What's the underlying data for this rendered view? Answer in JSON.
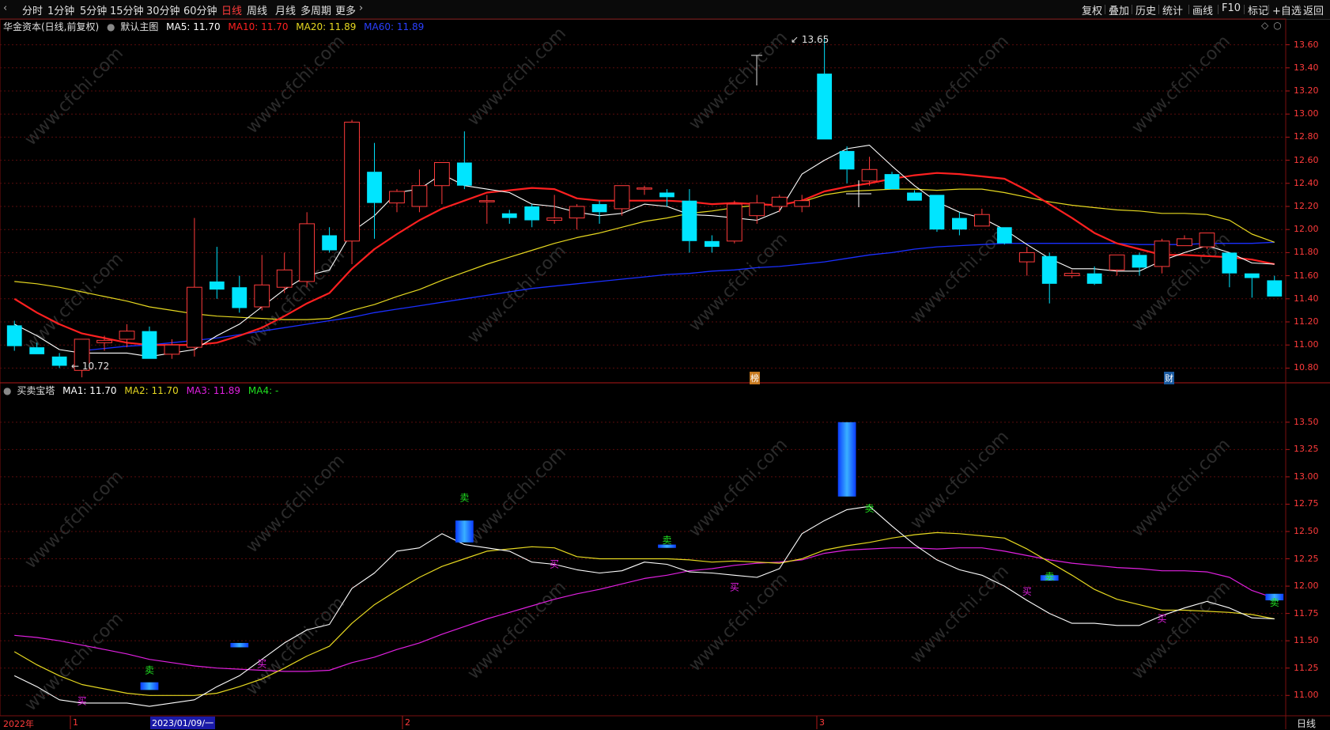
{
  "toolbar": {
    "periods": [
      "分时",
      "1分钟",
      "5分钟",
      "15分钟",
      "30分钟",
      "60分钟",
      "日线",
      "周线",
      "月线",
      "多周期",
      "更多"
    ],
    "active_period": "日线",
    "more_arrow": "›",
    "right_items": [
      "复权",
      "叠加",
      "历史",
      "统计",
      "画线",
      "F10",
      "标记",
      "+自选",
      "返回"
    ]
  },
  "main_panel": {
    "stock_title": "华金资本(日线,前复权)",
    "indicator_name": "默认主图",
    "ma5": "MA5: 11.70",
    "ma10": "MA10: 11.70",
    "ma20": "MA20: 11.89",
    "ma60": "MA60: 11.89",
    "high_label": "13.65",
    "low_label": "10.72",
    "badge_bang": "榜",
    "badge_cai": "财",
    "y_ticks": [
      "13.60",
      "13.40",
      "13.20",
      "13.00",
      "12.80",
      "12.60",
      "12.40",
      "12.20",
      "12.00",
      "11.80",
      "11.60",
      "11.40",
      "11.20",
      "11.00",
      "10.80"
    ]
  },
  "sub_panel": {
    "indicator_name": "买卖宝塔",
    "ma1": "MA1: 11.70",
    "ma2": "MA2: 11.70",
    "ma3": "MA3: 11.89",
    "ma4": "MA4: -",
    "buy_label": "买",
    "sell_label": "卖",
    "y_ticks": [
      "13.50",
      "13.25",
      "13.00",
      "12.75",
      "12.50",
      "12.25",
      "12.00",
      "11.75",
      "11.50",
      "11.25",
      "11.00"
    ]
  },
  "bottom_axis": {
    "year_label": "2022年",
    "month1": "1",
    "cursor_date": "2023/01/09/一",
    "month2": "2",
    "month3": "3",
    "period_label": "日线"
  },
  "watermark": "www.cfchi.com",
  "colors": {
    "up": "#ff3b3b",
    "down": "#00e5ff",
    "ma5": "#ffffff",
    "ma10": "#ff2020",
    "ma20": "#e6d820",
    "ma60": "#1a2fff",
    "ma3_sub": "#e020e0",
    "buy": "#e020e0",
    "sell": "#20e020"
  },
  "chart_data": {
    "type": "candlestick",
    "ylim_main": [
      10.7,
      13.7
    ],
    "ylim_sub": [
      10.85,
      13.6
    ],
    "candles": [
      {
        "o": 11.17,
        "h": 11.21,
        "l": 10.95,
        "c": 10.99
      },
      {
        "o": 10.98,
        "h": 11.02,
        "l": 10.92,
        "c": 10.92
      },
      {
        "o": 10.9,
        "h": 10.93,
        "l": 10.8,
        "c": 10.82
      },
      {
        "o": 10.78,
        "h": 11.05,
        "l": 10.72,
        "c": 11.05
      },
      {
        "o": 11.02,
        "h": 11.08,
        "l": 10.95,
        "c": 11.04
      },
      {
        "o": 11.05,
        "h": 11.18,
        "l": 10.98,
        "c": 11.12
      },
      {
        "o": 11.12,
        "h": 11.16,
        "l": 10.88,
        "c": 10.88
      },
      {
        "o": 10.92,
        "h": 11.05,
        "l": 10.88,
        "c": 11.0
      },
      {
        "o": 10.98,
        "h": 12.1,
        "l": 10.9,
        "c": 11.5
      },
      {
        "o": 11.55,
        "h": 11.85,
        "l": 11.4,
        "c": 11.48
      },
      {
        "o": 11.5,
        "h": 11.6,
        "l": 11.28,
        "c": 11.32
      },
      {
        "o": 11.33,
        "h": 11.78,
        "l": 11.3,
        "c": 11.52
      },
      {
        "o": 11.5,
        "h": 11.8,
        "l": 11.45,
        "c": 11.65
      },
      {
        "o": 11.55,
        "h": 12.15,
        "l": 11.5,
        "c": 12.05
      },
      {
        "o": 11.95,
        "h": 12.02,
        "l": 11.8,
        "c": 11.82
      },
      {
        "o": 11.9,
        "h": 12.95,
        "l": 11.7,
        "c": 12.93
      },
      {
        "o": 12.5,
        "h": 12.75,
        "l": 11.92,
        "c": 12.23
      },
      {
        "o": 12.23,
        "h": 12.35,
        "l": 12.15,
        "c": 12.33
      },
      {
        "o": 12.2,
        "h": 12.52,
        "l": 12.15,
        "c": 12.38
      },
      {
        "o": 12.38,
        "h": 12.58,
        "l": 12.22,
        "c": 12.58
      },
      {
        "o": 12.58,
        "h": 12.85,
        "l": 12.35,
        "c": 12.38
      },
      {
        "o": 12.25,
        "h": 12.3,
        "l": 12.05,
        "c": 12.25
      },
      {
        "o": 12.14,
        "h": 12.17,
        "l": 12.05,
        "c": 12.1
      },
      {
        "o": 12.2,
        "h": 12.22,
        "l": 12.02,
        "c": 12.08
      },
      {
        "o": 12.08,
        "h": 12.3,
        "l": 12.05,
        "c": 12.1
      },
      {
        "o": 12.1,
        "h": 12.22,
        "l": 12.0,
        "c": 12.2
      },
      {
        "o": 12.22,
        "h": 12.25,
        "l": 12.05,
        "c": 12.15
      },
      {
        "o": 12.18,
        "h": 12.38,
        "l": 12.12,
        "c": 12.38
      },
      {
        "o": 12.35,
        "h": 12.38,
        "l": 12.3,
        "c": 12.36
      },
      {
        "o": 12.32,
        "h": 12.35,
        "l": 12.2,
        "c": 12.28
      },
      {
        "o": 12.25,
        "h": 12.35,
        "l": 11.8,
        "c": 11.9
      },
      {
        "o": 11.9,
        "h": 11.95,
        "l": 11.8,
        "c": 11.85
      },
      {
        "o": 11.9,
        "h": 12.25,
        "l": 11.88,
        "c": 12.22
      },
      {
        "o": 12.12,
        "h": 12.3,
        "l": 12.05,
        "c": 12.23
      },
      {
        "o": 12.2,
        "h": 12.3,
        "l": 12.15,
        "c": 12.28
      },
      {
        "o": 12.2,
        "h": 12.3,
        "l": 12.15,
        "c": 12.25
      },
      {
        "o": 13.35,
        "h": 13.65,
        "l": 12.78,
        "c": 12.78
      },
      {
        "o": 12.68,
        "h": 12.72,
        "l": 12.4,
        "c": 12.52
      },
      {
        "o": 12.42,
        "h": 12.63,
        "l": 12.38,
        "c": 12.52
      },
      {
        "o": 12.48,
        "h": 12.5,
        "l": 12.35,
        "c": 12.35
      },
      {
        "o": 12.32,
        "h": 12.34,
        "l": 12.25,
        "c": 12.25
      },
      {
        "o": 12.3,
        "h": 12.3,
        "l": 11.98,
        "c": 12.0
      },
      {
        "o": 12.1,
        "h": 12.15,
        "l": 11.95,
        "c": 12.0
      },
      {
        "o": 12.03,
        "h": 12.18,
        "l": 12.03,
        "c": 12.13
      },
      {
        "o": 12.02,
        "h": 12.02,
        "l": 11.87,
        "c": 11.88
      },
      {
        "o": 11.72,
        "h": 11.85,
        "l": 11.6,
        "c": 11.8
      },
      {
        "o": 11.77,
        "h": 11.8,
        "l": 11.36,
        "c": 11.53
      },
      {
        "o": 11.6,
        "h": 11.65,
        "l": 11.58,
        "c": 11.62
      },
      {
        "o": 11.62,
        "h": 11.68,
        "l": 11.52,
        "c": 11.53
      },
      {
        "o": 11.65,
        "h": 11.78,
        "l": 11.6,
        "c": 11.78
      },
      {
        "o": 11.78,
        "h": 11.8,
        "l": 11.6,
        "c": 11.67
      },
      {
        "o": 11.68,
        "h": 11.92,
        "l": 11.62,
        "c": 11.9
      },
      {
        "o": 11.86,
        "h": 11.95,
        "l": 11.86,
        "c": 11.92
      },
      {
        "o": 11.85,
        "h": 11.97,
        "l": 11.83,
        "c": 11.97
      },
      {
        "o": 11.8,
        "h": 11.8,
        "l": 11.5,
        "c": 11.62
      },
      {
        "o": 11.62,
        "h": 11.62,
        "l": 11.41,
        "c": 11.58
      },
      {
        "o": 11.56,
        "h": 11.6,
        "l": 11.42,
        "c": 11.42
      }
    ],
    "ma5": [
      11.18,
      11.08,
      10.96,
      10.93,
      10.93,
      10.93,
      10.9,
      10.93,
      10.96,
      11.08,
      11.18,
      11.33,
      11.48,
      11.6,
      11.65,
      11.98,
      12.12,
      12.32,
      12.35,
      12.48,
      12.38,
      12.35,
      12.32,
      12.22,
      12.2,
      12.15,
      12.12,
      12.14,
      12.22,
      12.2,
      12.13,
      12.12,
      12.1,
      12.08,
      12.16,
      12.48,
      12.6,
      12.7,
      12.73,
      12.55,
      12.38,
      12.24,
      12.15,
      12.1,
      12.0,
      11.87,
      11.75,
      11.66,
      11.66,
      11.64,
      11.64,
      11.73,
      11.8,
      11.86,
      11.8,
      11.71,
      11.7
    ],
    "ma10": [
      11.4,
      11.28,
      11.18,
      11.1,
      11.06,
      11.02,
      11.0,
      11.0,
      11.0,
      11.02,
      11.08,
      11.15,
      11.25,
      11.36,
      11.45,
      11.66,
      11.83,
      11.96,
      12.08,
      12.18,
      12.25,
      12.32,
      12.34,
      12.36,
      12.35,
      12.27,
      12.25,
      12.25,
      12.25,
      12.25,
      12.24,
      12.22,
      12.23,
      12.22,
      12.21,
      12.25,
      12.33,
      12.37,
      12.4,
      12.44,
      12.47,
      12.49,
      12.48,
      12.46,
      12.44,
      12.34,
      12.22,
      12.1,
      11.97,
      11.88,
      11.83,
      11.78,
      11.78,
      11.77,
      11.76,
      11.74,
      11.7
    ],
    "ma20": [
      11.55,
      11.53,
      11.5,
      11.46,
      11.42,
      11.38,
      11.33,
      11.3,
      11.27,
      11.25,
      11.24,
      11.23,
      11.22,
      11.22,
      11.23,
      11.3,
      11.35,
      11.42,
      11.48,
      11.56,
      11.63,
      11.7,
      11.76,
      11.82,
      11.88,
      11.93,
      11.97,
      12.02,
      12.07,
      12.1,
      12.14,
      12.16,
      12.19,
      12.21,
      12.22,
      12.24,
      12.3,
      12.33,
      12.34,
      12.35,
      12.35,
      12.34,
      12.35,
      12.35,
      12.32,
      12.28,
      12.24,
      12.21,
      12.19,
      12.17,
      12.16,
      12.14,
      12.14,
      12.13,
      12.08,
      11.96,
      11.89
    ],
    "ma60_start": 3,
    "ma60": [
      10.95,
      10.97,
      10.99,
      11.0,
      11.02,
      11.04,
      11.06,
      11.09,
      11.12,
      11.15,
      11.18,
      11.21,
      11.24,
      11.28,
      11.31,
      11.34,
      11.37,
      11.4,
      11.43,
      11.46,
      11.49,
      11.51,
      11.53,
      11.55,
      11.57,
      11.59,
      11.61,
      11.62,
      11.64,
      11.65,
      11.67,
      11.68,
      11.7,
      11.72,
      11.75,
      11.78,
      11.8,
      11.83,
      11.85,
      11.86,
      11.87,
      11.88,
      11.88,
      11.88,
      11.88,
      11.88,
      11.88,
      11.87,
      11.87,
      11.87,
      11.88,
      11.88,
      11.88,
      11.89
    ],
    "sub_signals": [
      {
        "type": "buy",
        "i": 3,
        "v": 10.92
      },
      {
        "type": "sell",
        "i": 6,
        "v": 11.2
      },
      {
        "type": "buy",
        "i": 11,
        "v": 11.26
      },
      {
        "type": "sell",
        "i": 20,
        "v": 12.78
      },
      {
        "type": "buy",
        "i": 24,
        "v": 12.17
      },
      {
        "type": "sell",
        "i": 29,
        "v": 12.39
      },
      {
        "type": "buy",
        "i": 32,
        "v": 11.96
      },
      {
        "type": "sell",
        "i": 38,
        "v": 12.68
      },
      {
        "type": "buy",
        "i": 45,
        "v": 11.92
      },
      {
        "type": "sell",
        "i": 46,
        "v": 12.06
      },
      {
        "type": "buy",
        "i": 51,
        "v": 11.67
      },
      {
        "type": "sell",
        "i": 56,
        "v": 11.82
      }
    ],
    "sub_bars": [
      {
        "i": 6,
        "lo": 11.05,
        "hi": 11.12
      },
      {
        "i": 10,
        "lo": 11.44,
        "hi": 11.48
      },
      {
        "i": 20,
        "lo": 12.4,
        "hi": 12.6
      },
      {
        "i": 29,
        "lo": 12.35,
        "hi": 12.38
      },
      {
        "i": 37,
        "lo": 12.82,
        "hi": 13.5
      },
      {
        "i": 46,
        "lo": 12.05,
        "hi": 12.1
      },
      {
        "i": 56,
        "lo": 11.87,
        "hi": 11.93
      }
    ]
  }
}
